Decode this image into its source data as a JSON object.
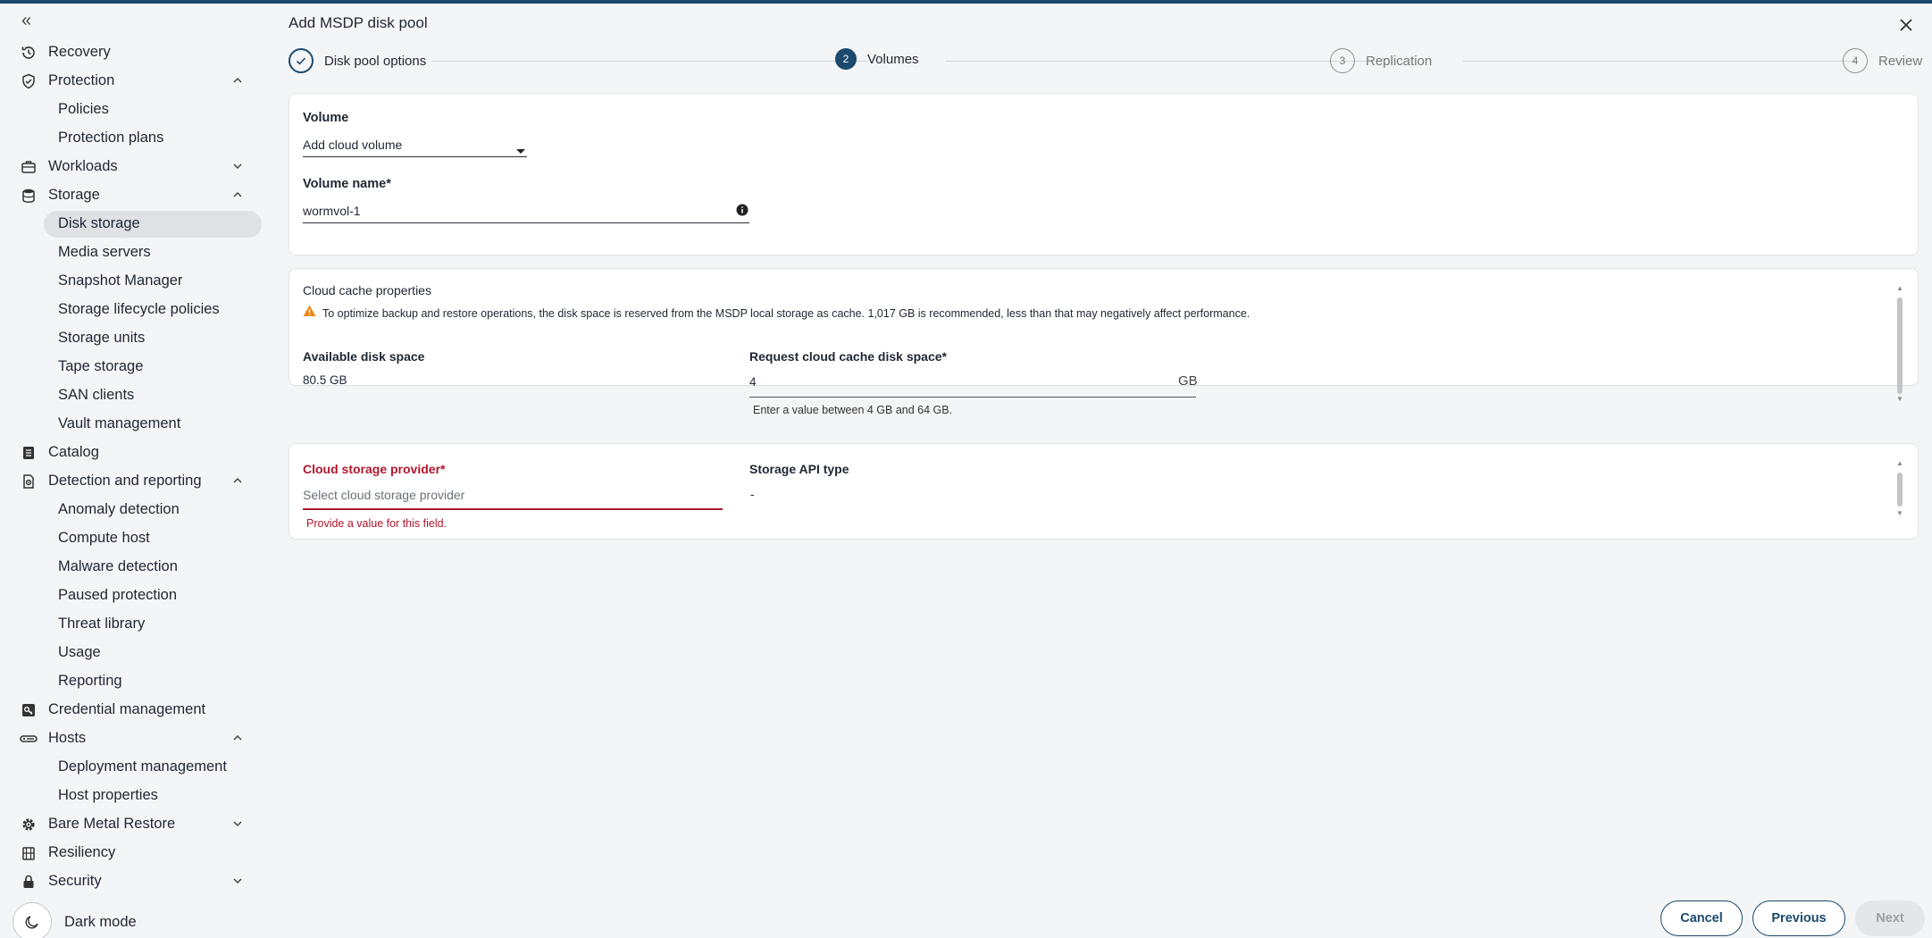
{
  "sidebar": {
    "collapse_icon": "«",
    "items": [
      {
        "label": "Recovery",
        "icon": "history-icon"
      },
      {
        "label": "Protection",
        "icon": "shield-icon",
        "expanded": true
      },
      {
        "label": "Policies"
      },
      {
        "label": "Protection plans"
      },
      {
        "label": "Workloads",
        "icon": "briefcase-icon",
        "expanded": false
      },
      {
        "label": "Storage",
        "icon": "database-icon",
        "expanded": true
      },
      {
        "label": "Disk storage",
        "active": true
      },
      {
        "label": "Media servers"
      },
      {
        "label": "Snapshot Manager"
      },
      {
        "label": "Storage lifecycle policies"
      },
      {
        "label": "Storage units"
      },
      {
        "label": "Tape storage"
      },
      {
        "label": "SAN clients"
      },
      {
        "label": "Vault management"
      },
      {
        "label": "Catalog",
        "icon": "catalog-icon"
      },
      {
        "label": "Detection and reporting",
        "icon": "report-icon",
        "expanded": true
      },
      {
        "label": "Anomaly detection"
      },
      {
        "label": "Compute host"
      },
      {
        "label": "Malware detection"
      },
      {
        "label": "Paused protection"
      },
      {
        "label": "Threat library"
      },
      {
        "label": "Usage"
      },
      {
        "label": "Reporting"
      },
      {
        "label": "Credential management",
        "icon": "key-icon"
      },
      {
        "label": "Hosts",
        "icon": "server-icon",
        "expanded": true
      },
      {
        "label": "Deployment management"
      },
      {
        "label": "Host properties"
      },
      {
        "label": "Bare Metal Restore",
        "icon": "gear-icon",
        "expanded": false
      },
      {
        "label": "Resiliency",
        "icon": "building-icon"
      },
      {
        "label": "Security",
        "icon": "lock-icon",
        "expanded": false
      }
    ],
    "dark_mode_label": "Dark mode"
  },
  "dialog": {
    "title": "Add MSDP disk pool",
    "steps": [
      {
        "number": "1",
        "label": "Disk pool options",
        "state": "complete"
      },
      {
        "number": "2",
        "label": "Volumes",
        "state": "current"
      },
      {
        "number": "3",
        "label": "Replication",
        "state": "pending"
      },
      {
        "number": "4",
        "label": "Review",
        "state": "pending"
      }
    ],
    "volume": {
      "label": "Volume",
      "value": "Add cloud volume",
      "name_label": "Volume name*",
      "name_value": "wormvol-1"
    },
    "cache": {
      "title": "Cloud cache properties",
      "warning": "To optimize backup and restore operations, the disk space is reserved from the MSDP local storage as cache. 1,017 GB is recommended, less than that may negatively affect performance.",
      "available_label": "Available disk space",
      "available_value": "80.5 GB",
      "request_label": "Request cloud cache disk space*",
      "request_value": "4",
      "unit": "GB",
      "helper": "Enter a value between 4 GB and 64 GB."
    },
    "provider": {
      "label": "Cloud storage provider*",
      "placeholder": "Select cloud storage provider",
      "error": "Provide a value for this field.",
      "api_label": "Storage API type",
      "api_value": "-"
    },
    "buttons": {
      "cancel": "Cancel",
      "previous": "Previous",
      "next": "Next"
    }
  },
  "colors": {
    "accent": "#1b4a6e",
    "error": "#b0162e",
    "warning": "#e8891c"
  }
}
